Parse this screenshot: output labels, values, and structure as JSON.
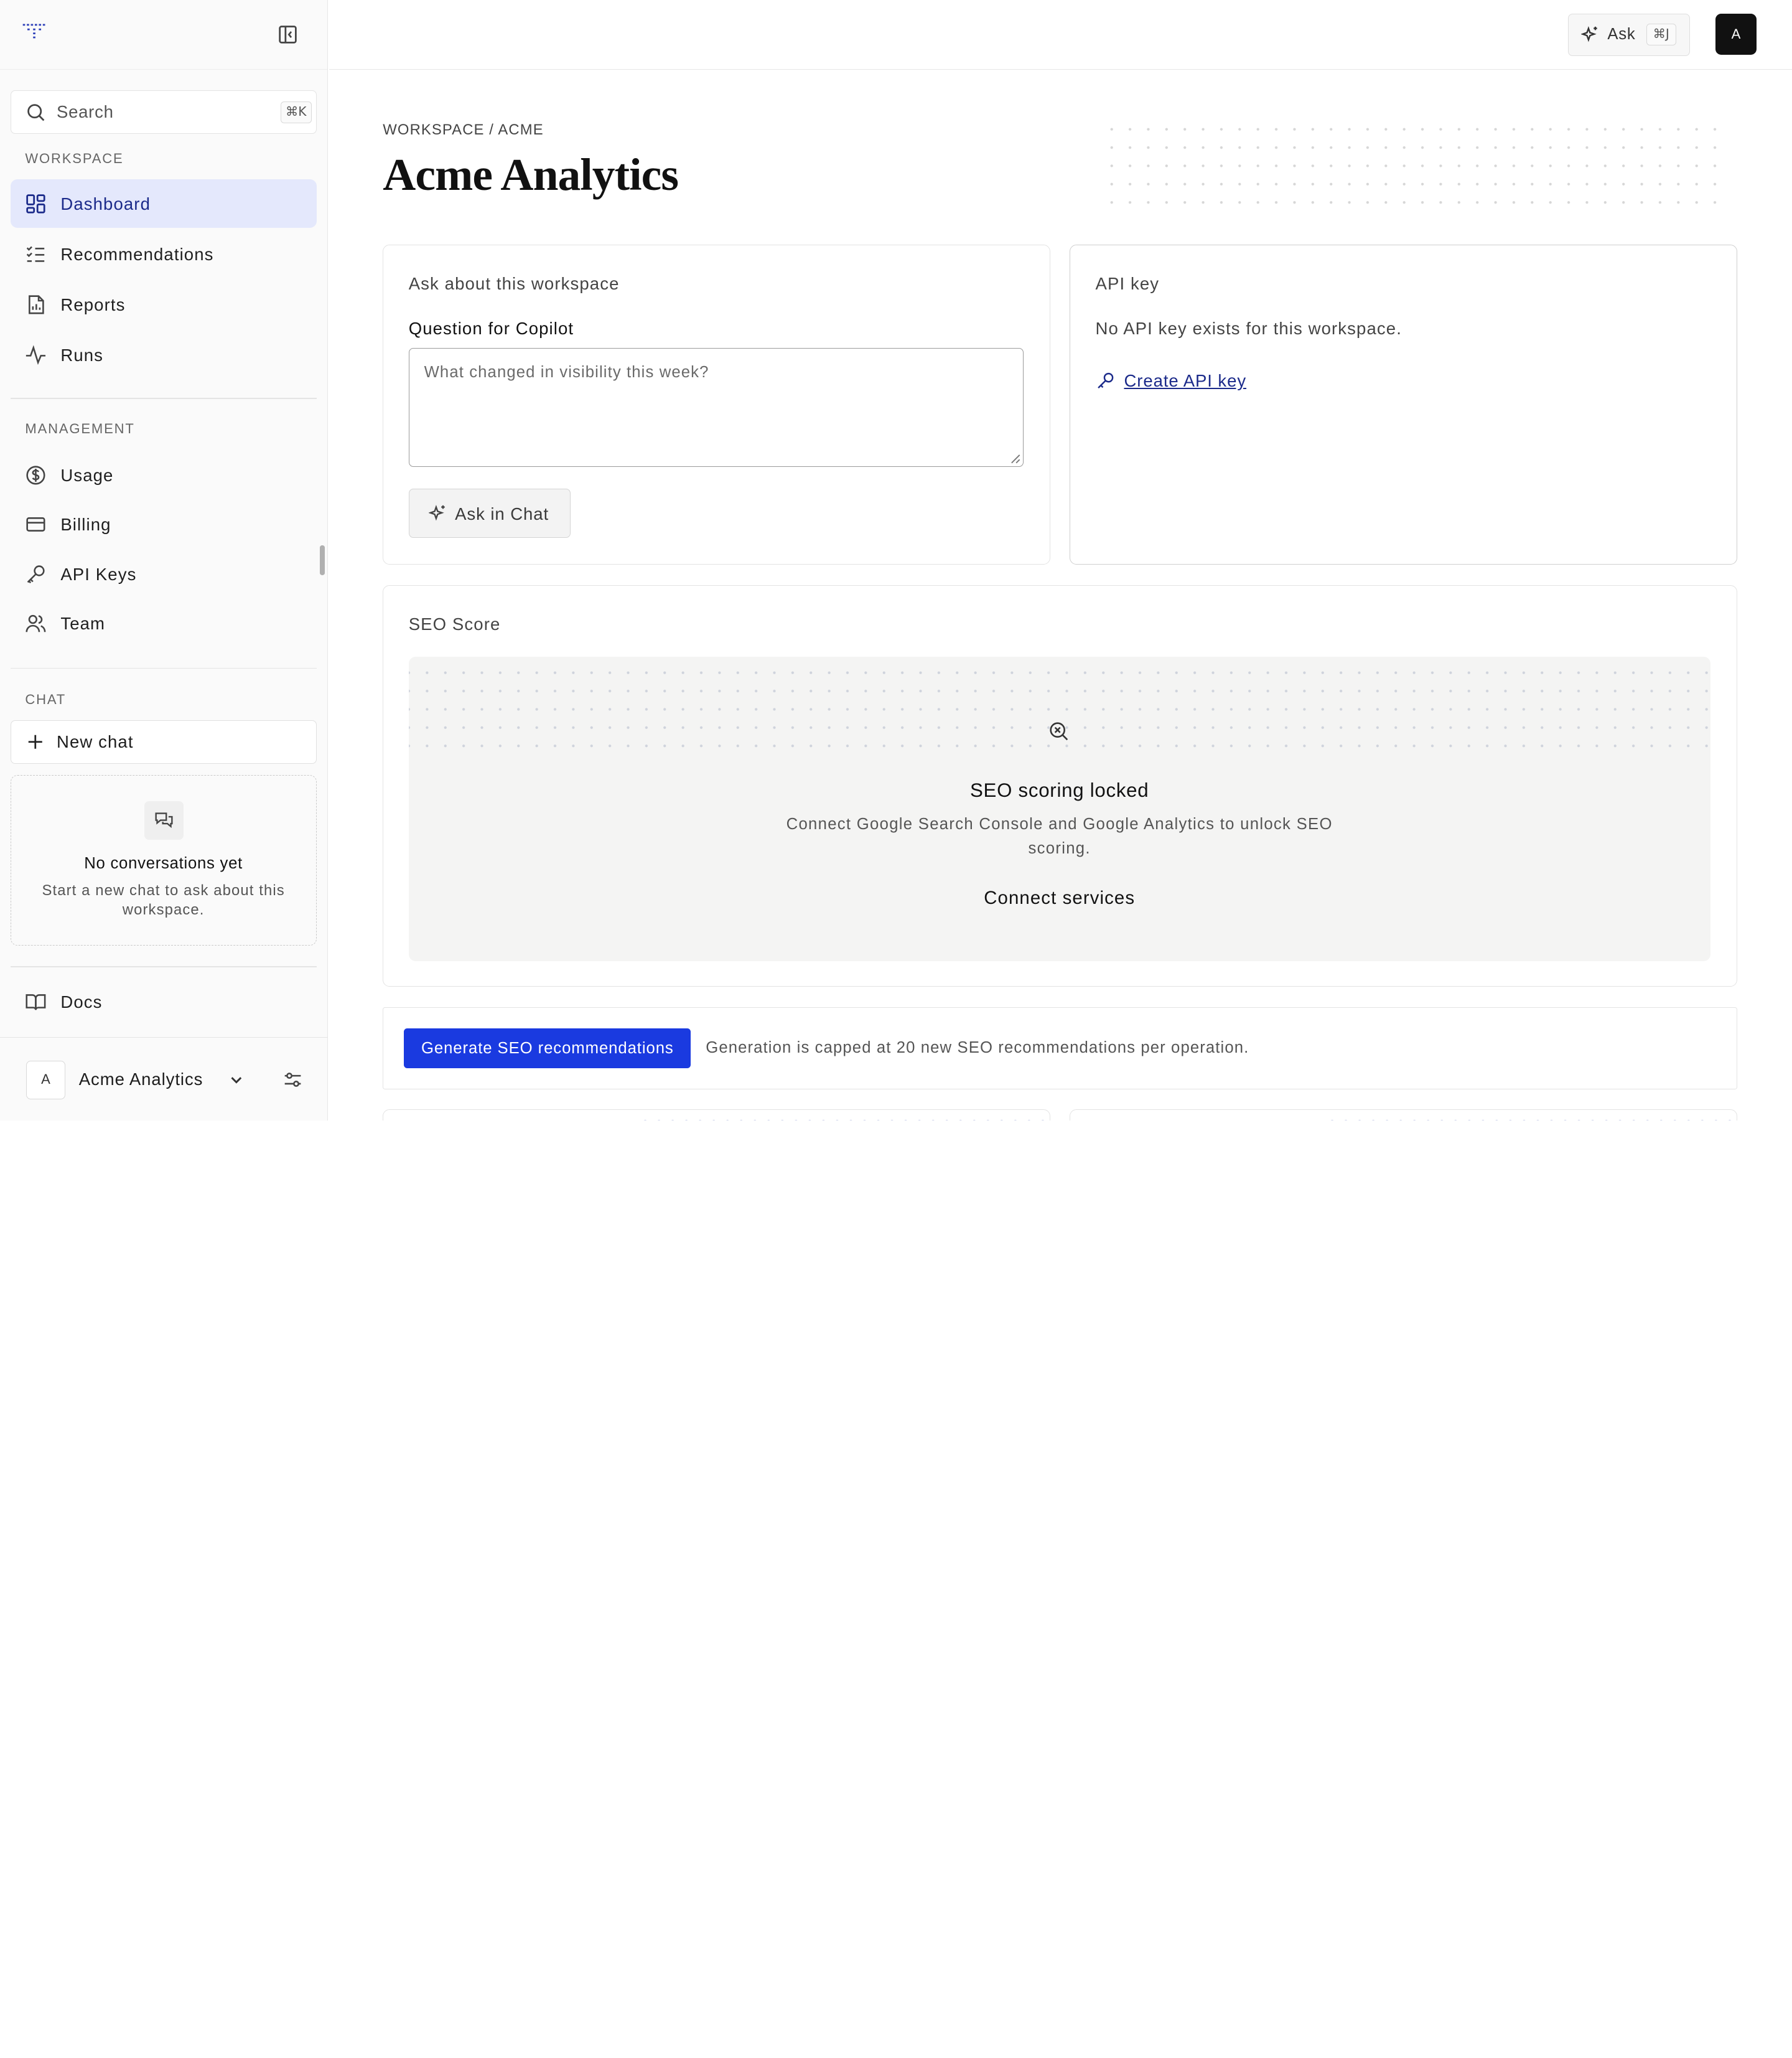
{
  "sidebar": {
    "search": {
      "label": "Search",
      "shortcut": "⌘K"
    },
    "sections": {
      "workspace": "WORKSPACE",
      "management": "MANAGEMENT",
      "chat": "CHAT"
    },
    "workspace_items": [
      {
        "label": "Dashboard",
        "icon": "dashboard-icon",
        "active": true
      },
      {
        "label": "Recommendations",
        "icon": "checklist-icon"
      },
      {
        "label": "Reports",
        "icon": "report-icon"
      },
      {
        "label": "Runs",
        "icon": "activity-icon"
      }
    ],
    "management_items": [
      {
        "label": "Usage",
        "icon": "dollar-icon"
      },
      {
        "label": "Billing",
        "icon": "credit-card-icon"
      },
      {
        "label": "API Keys",
        "icon": "key-icon"
      },
      {
        "label": "Team",
        "icon": "users-icon"
      }
    ],
    "new_chat": "New chat",
    "empty_chat": {
      "title": "No conversations yet",
      "subtitle": "Start a new chat to ask about this workspace."
    },
    "docs": "Docs",
    "workspace_switcher": {
      "avatar": "A",
      "name": "Acme Analytics"
    }
  },
  "topbar": {
    "ask_label": "Ask",
    "ask_shortcut": "⌘J",
    "user_initial": "A"
  },
  "main": {
    "breadcrumb": "WORKSPACE / ACME",
    "title": "Acme Analytics",
    "ask_card": {
      "title": "Ask about this workspace",
      "field_label": "Question for Copilot",
      "placeholder": "What changed in visibility this week?",
      "button": "Ask in Chat"
    },
    "api_card": {
      "title": "API key",
      "message": "No API key exists for this workspace.",
      "link": "Create API key"
    },
    "seo_card": {
      "title": "SEO Score",
      "locked_title": "SEO scoring locked",
      "locked_sub": "Connect Google Search Console and Google Analytics to unlock SEO scoring.",
      "connect": "Connect services"
    },
    "generate": {
      "button": "Generate SEO recommendations",
      "note": "Generation is capped at 20 new SEO recommendations per operation."
    }
  },
  "colors": {
    "accent": "#1a3ae0",
    "active_nav_bg": "#e4e8fc",
    "link": "#1b2a8a"
  }
}
